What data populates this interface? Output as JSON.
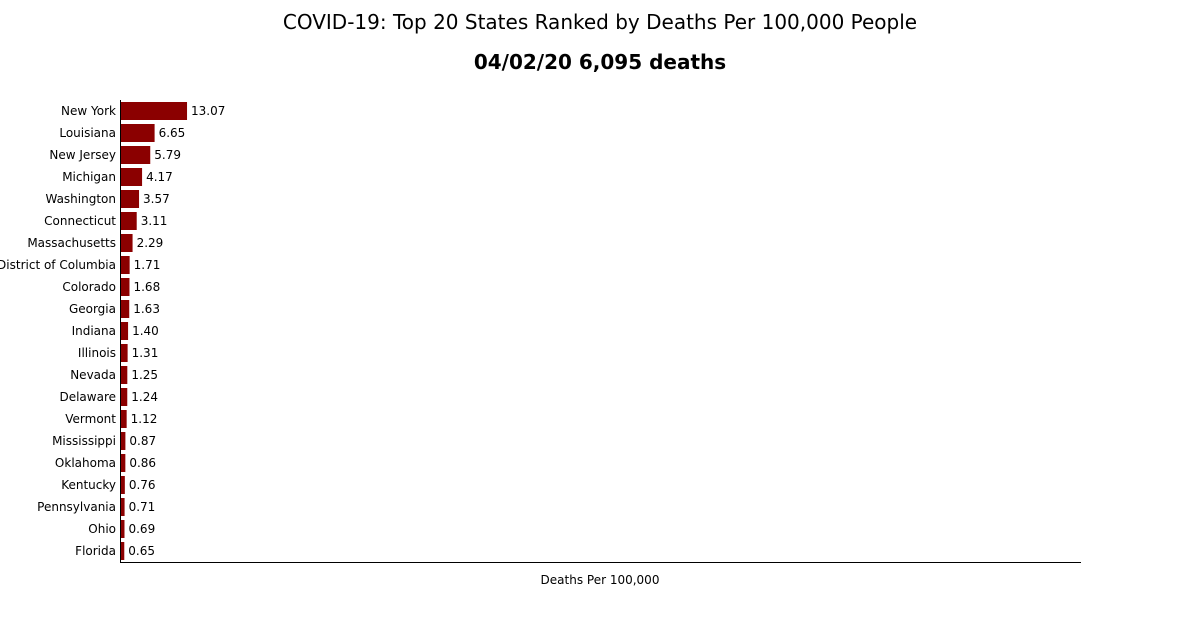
{
  "chart_data": {
    "type": "bar",
    "orientation": "horizontal",
    "title": "COVID-19: Top 20 States Ranked by Deaths Per 100,000 People",
    "subtitle": "04/02/20 6,095 deaths",
    "xlabel": "Deaths Per 100,000",
    "ylabel": "",
    "xlim": [
      0,
      190
    ],
    "bar_color": "#8b0000",
    "grid": false,
    "categories": [
      "New York",
      "Louisiana",
      "New Jersey",
      "Michigan",
      "Washington",
      "Connecticut",
      "Massachusetts",
      "District of Columbia",
      "Colorado",
      "Georgia",
      "Indiana",
      "Illinois",
      "Nevada",
      "Delaware",
      "Vermont",
      "Mississippi",
      "Oklahoma",
      "Kentucky",
      "Pennsylvania",
      "Ohio",
      "Florida"
    ],
    "values": [
      13.07,
      6.65,
      5.79,
      4.17,
      3.57,
      3.11,
      2.29,
      1.71,
      1.68,
      1.63,
      1.4,
      1.31,
      1.25,
      1.24,
      1.12,
      0.87,
      0.86,
      0.76,
      0.71,
      0.69,
      0.65
    ],
    "value_labels": [
      "13.07",
      "6.65",
      "5.79",
      "4.17",
      "3.57",
      "3.11",
      "2.29",
      "1.71",
      "1.68",
      "1.63",
      "1.40",
      "1.31",
      "1.25",
      "1.24",
      "1.12",
      "0.87",
      "0.86",
      "0.76",
      "0.71",
      "0.69",
      "0.65"
    ]
  }
}
